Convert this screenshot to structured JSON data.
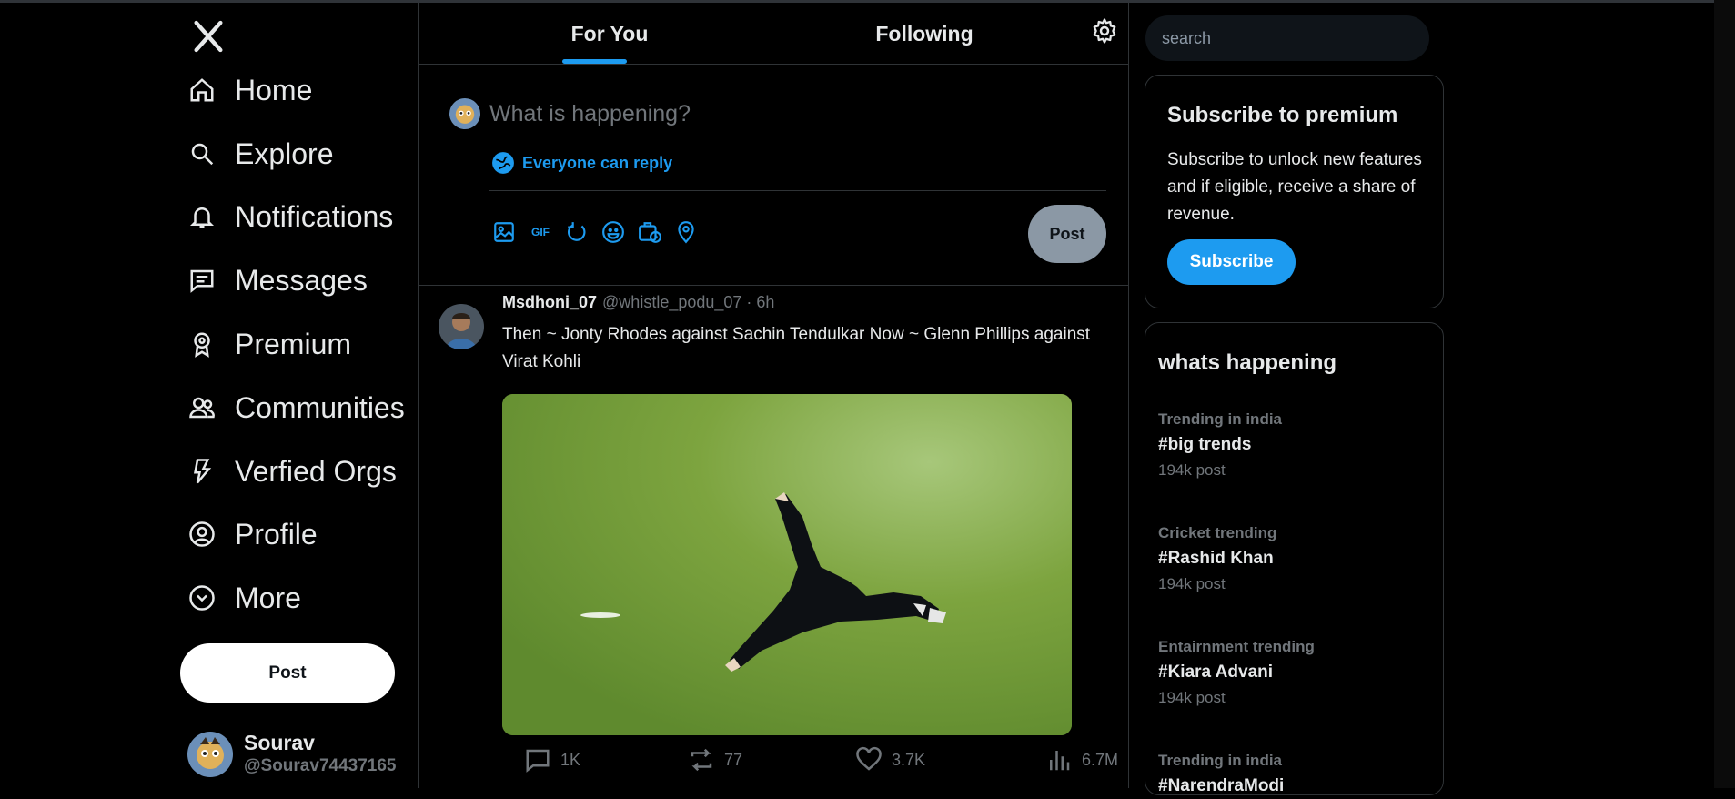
{
  "logo": "X",
  "nav": {
    "items": [
      {
        "label": "Home",
        "icon": "home-icon"
      },
      {
        "label": "Explore",
        "icon": "search-icon"
      },
      {
        "label": "Notifications",
        "icon": "bell-icon"
      },
      {
        "label": "Messages",
        "icon": "message-icon"
      },
      {
        "label": "Premium",
        "icon": "badge-icon"
      },
      {
        "label": "Communities",
        "icon": "people-icon"
      },
      {
        "label": "Verfied Orgs",
        "icon": "bolt-icon"
      },
      {
        "label": "Profile",
        "icon": "user-icon"
      },
      {
        "label": "More",
        "icon": "chevron-circle-icon"
      }
    ],
    "post_label": "Post"
  },
  "user": {
    "name": "Sourav",
    "handle": "@Sourav74437165"
  },
  "tabs": {
    "for_you": "For You",
    "following": "Following"
  },
  "composer": {
    "placeholder": "What is happening?",
    "reply_setting": "Everyone can reply",
    "gif_label": "GIF",
    "post_label": "Post"
  },
  "tweet": {
    "name": "Msdhoni_07",
    "handle_time": "@whistle_podu_07 · 6h",
    "text": "Then ~ Jonty Rhodes against Sachin Tendulkar Now ~ Glenn Phillips against Virat Kohli",
    "replies": "1K",
    "reposts": "77",
    "likes": "3.7K",
    "views": "6.7M"
  },
  "search": {
    "placeholder": "search"
  },
  "premium": {
    "title": "Subscribe to premium",
    "text": "Subscribe to unlock new features and if eligible, receive a share of revenue.",
    "button": "Subscribe"
  },
  "trends": {
    "title": "whats happening",
    "items": [
      {
        "category": "Trending in india",
        "tag": "#big trends",
        "count": "194k post"
      },
      {
        "category": "Cricket trending",
        "tag": "#Rashid Khan",
        "count": "194k post"
      },
      {
        "category": "Entairnment trending",
        "tag": "#Kiara Advani",
        "count": "194k post"
      },
      {
        "category": "Trending in india",
        "tag": "#NarendraModi",
        "count": ""
      }
    ]
  },
  "colors": {
    "accent": "#1d9bf0",
    "background": "#000000",
    "muted": "#71767b",
    "border": "#2f3336"
  }
}
